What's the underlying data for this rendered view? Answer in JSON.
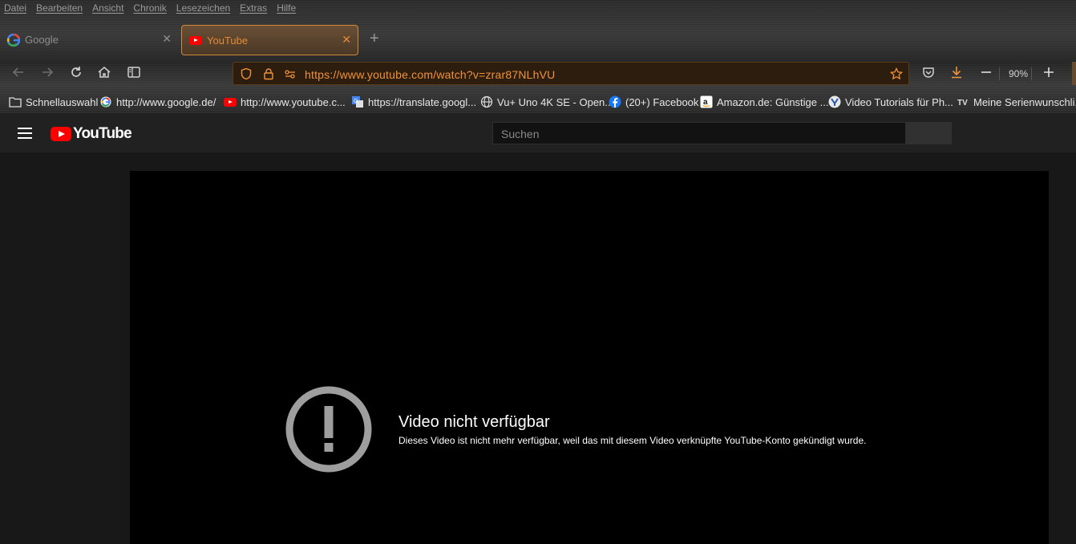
{
  "menu": [
    "Datei",
    "Bearbeiten",
    "Ansicht",
    "Chronik",
    "Lesezeichen",
    "Extras",
    "Hilfe"
  ],
  "tabs": [
    {
      "label": "Google",
      "icon": "google-icon",
      "active": false
    },
    {
      "label": "YouTube",
      "icon": "youtube-icon",
      "active": true
    }
  ],
  "address": {
    "prefix": "https://www.",
    "host": "youtube.com",
    "path": "/watch?v=zrar87NLhVU"
  },
  "zoom": "90%",
  "bookmarks": [
    {
      "label": "Schnellauswahl",
      "icon": "folder-icon"
    },
    {
      "label": "http://www.google.de/",
      "icon": "google-icon"
    },
    {
      "label": "http://www.youtube.c...",
      "icon": "youtube-icon"
    },
    {
      "label": "https://translate.googl...",
      "icon": "translate-icon"
    },
    {
      "label": "Vu+ Uno 4K SE - Open...",
      "icon": "globe-icon"
    },
    {
      "label": "(20+) Facebook",
      "icon": "facebook-icon"
    },
    {
      "label": "Amazon.de: Günstige ...",
      "icon": "amazon-icon"
    },
    {
      "label": "Video Tutorials für Ph...",
      "icon": "tutorials-icon"
    },
    {
      "label": "Meine Serienwunschli...",
      "icon": "tv-icon"
    }
  ],
  "youtube": {
    "logo": "YouTube",
    "search_placeholder": "Suchen",
    "error_title": "Video nicht verfügbar",
    "error_text": "Dieses Video ist nicht mehr verfügbar, weil das mit diesem Video verknüpfte YouTube-Konto gekündigt wurde."
  },
  "colors": {
    "accent": "#f0923a",
    "youtube_red": "#ff0000",
    "player_bg": "#000000"
  }
}
